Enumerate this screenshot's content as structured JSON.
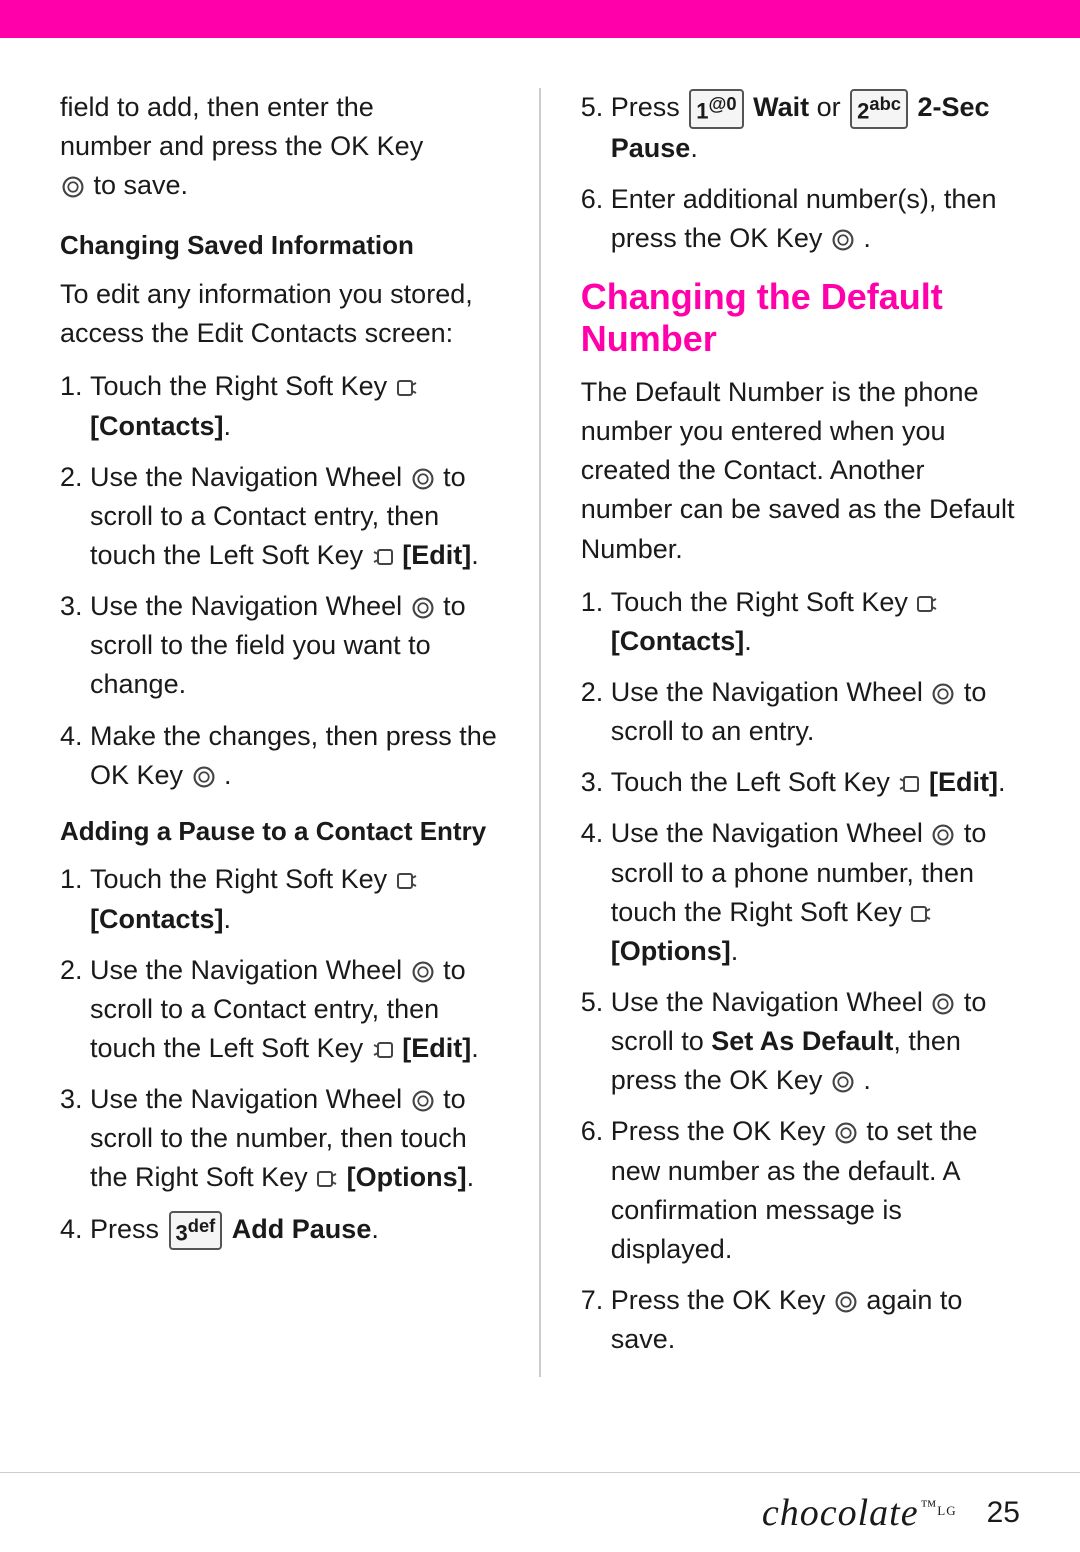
{
  "topbar": {
    "color": "#ff00aa"
  },
  "left_col": {
    "intro": {
      "text": "field to add, then enter the number and press the OK Key",
      "text2": "to save."
    },
    "section1": {
      "heading": "Changing Saved Information",
      "intro": "To edit any information you stored, access the Edit Contacts screen:",
      "steps": [
        "Touch the Right Soft Key [Contacts].",
        "Use the Navigation Wheel to scroll to a Contact entry, then touch the Left Soft Key [Edit].",
        "Use the Navigation Wheel to scroll to the field you want to change.",
        "Make the changes, then press the OK Key ."
      ]
    },
    "section2": {
      "heading": "Adding a Pause to a Contact Entry",
      "steps": [
        "Touch the Right Soft Key [Contacts].",
        "Use the Navigation Wheel to scroll to a Contact entry, then touch the Left Soft Key [Edit].",
        "Use the Navigation Wheel to scroll to the number, then touch the Right Soft Key [Options].",
        "Press [3def] Add Pause."
      ]
    }
  },
  "right_col": {
    "right_intro": {
      "step5": "Press [1@0] Wait or [2abc] 2-Sec Pause.",
      "step6": "Enter additional number(s), then press the OK Key ."
    },
    "section_main": {
      "heading": "Changing the Default Number",
      "intro": "The Default Number is the phone number you entered when you created the Contact. Another number can be saved as the Default Number.",
      "steps": [
        "Touch the Right Soft Key [Contacts].",
        "Use the Navigation Wheel to scroll to an entry.",
        "Touch the Left Soft Key [Edit].",
        "Use the Navigation Wheel to scroll to a phone number, then touch the Right Soft Key [Options].",
        "Use the Navigation Wheel to scroll to Set As Default, then press the OK Key .",
        "Press the OK Key to set the new number as the default. A confirmation message is displayed.",
        "Press the OK Key again to save."
      ]
    }
  },
  "footer": {
    "brand": "chocolate",
    "sub": "by LG",
    "page": "25"
  }
}
